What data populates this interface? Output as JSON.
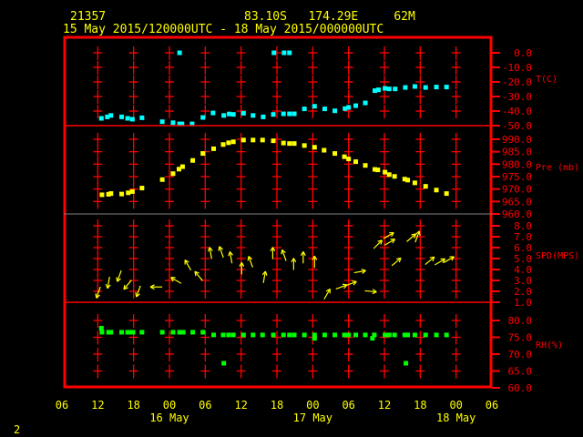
{
  "header": {
    "station_id": "21357",
    "location": "83.10S   174.29E     62M",
    "period": "15 May 2015/120000UTC - 18 May 2015/000000UTC"
  },
  "page_number": "2",
  "colors": {
    "axis": "#ff0000",
    "title": "#ffff00",
    "temperature": "#00ffff",
    "pressure": "#ffff00",
    "wind": "#ffff00",
    "rh": "#00ff00"
  },
  "chart_data": {
    "type": "scatter",
    "x_unit": "hours since 15 May 2015 12UTC",
    "xlim": [
      -6,
      66
    ],
    "x_ticks": [
      {
        "h": -6,
        "label": "06"
      },
      {
        "h": 0,
        "label": "12"
      },
      {
        "h": 6,
        "label": "18"
      },
      {
        "h": 12,
        "label": "00"
      },
      {
        "h": 18,
        "label": "06"
      },
      {
        "h": 24,
        "label": "12"
      },
      {
        "h": 30,
        "label": "18"
      },
      {
        "h": 36,
        "label": "00"
      },
      {
        "h": 42,
        "label": "06"
      },
      {
        "h": 48,
        "label": "12"
      },
      {
        "h": 54,
        "label": "18"
      },
      {
        "h": 60,
        "label": "00"
      },
      {
        "h": 66,
        "label": "06"
      }
    ],
    "date_labels": [
      {
        "h": 12,
        "label": "16 May"
      },
      {
        "h": 36,
        "label": "17 May"
      },
      {
        "h": 60,
        "label": "18 May"
      }
    ],
    "panels": [
      {
        "name": "temperature",
        "label": "T(C)",
        "ylim": [
          -50,
          0
        ],
        "ticks": [
          "0.0",
          "-10.0",
          "-20.0",
          "-30.0",
          "-40.0",
          "-50.0"
        ],
        "points": [
          [
            0.6,
            -45
          ],
          [
            1.6,
            -44
          ],
          [
            2.2,
            -43
          ],
          [
            4,
            -44
          ],
          [
            5,
            -45
          ],
          [
            5.8,
            -45.6
          ],
          [
            7.4,
            -44.6
          ],
          [
            10.8,
            -47.3
          ],
          [
            12.6,
            -48
          ],
          [
            13.7,
            -48.8
          ],
          [
            14.1,
            -48.8
          ],
          [
            15.8,
            -48.8
          ],
          [
            17.6,
            -44.4
          ],
          [
            19.3,
            -41.3
          ],
          [
            21.1,
            -43
          ],
          [
            22,
            -42
          ],
          [
            22.7,
            -42.3
          ],
          [
            24.4,
            -41.5
          ],
          [
            26,
            -43
          ],
          [
            27.7,
            -44
          ],
          [
            29.4,
            -42.3
          ],
          [
            31.1,
            -41.9
          ],
          [
            32.1,
            -41.9
          ],
          [
            32.9,
            -41.9
          ],
          [
            34.6,
            -38.5
          ],
          [
            36.3,
            -36.7
          ],
          [
            38,
            -38.5
          ],
          [
            39.7,
            -39.8
          ],
          [
            41.4,
            -38.3
          ],
          [
            42,
            -37.5
          ],
          [
            43.2,
            -36.3
          ],
          [
            44.8,
            -34.4
          ],
          [
            46.4,
            -26
          ],
          [
            47,
            -25.4
          ],
          [
            48.1,
            -24.4
          ],
          [
            48.8,
            -24.8
          ],
          [
            49.8,
            -24.8
          ],
          [
            51.5,
            -23.8
          ],
          [
            53.1,
            -23.1
          ],
          [
            54.9,
            -23.8
          ],
          [
            56.7,
            -23.5
          ],
          [
            58.4,
            -23.5
          ],
          [
            13.7,
            0
          ],
          [
            29.5,
            0
          ],
          [
            31.2,
            0
          ],
          [
            32.1,
            0
          ]
        ]
      },
      {
        "name": "pressure",
        "label": "Pre (mb)",
        "ylim": [
          960,
          990
        ],
        "ticks": [
          "990.0",
          "985.0",
          "980.0",
          "975.0",
          "970.0",
          "965.0",
          "960.0"
        ],
        "points": [
          [
            0.7,
            967.7
          ],
          [
            1.8,
            967.9
          ],
          [
            2.2,
            968.2
          ],
          [
            4,
            968
          ],
          [
            5.1,
            968.5
          ],
          [
            5.8,
            969
          ],
          [
            7.4,
            970.4
          ],
          [
            10.8,
            973.8
          ],
          [
            12.6,
            976.2
          ],
          [
            13.6,
            978
          ],
          [
            14.2,
            979
          ],
          [
            15.9,
            981.5
          ],
          [
            17.6,
            984.3
          ],
          [
            19.4,
            986.2
          ],
          [
            21,
            987.9
          ],
          [
            21.9,
            988.6
          ],
          [
            22.7,
            989
          ],
          [
            24.4,
            989.7
          ],
          [
            26,
            989.7
          ],
          [
            27.6,
            989.7
          ],
          [
            29.4,
            989.4
          ],
          [
            31.1,
            988.5
          ],
          [
            32.1,
            988.3
          ],
          [
            32.9,
            988.3
          ],
          [
            34.6,
            987.5
          ],
          [
            36.3,
            986.8
          ],
          [
            37.9,
            985.6
          ],
          [
            39.7,
            984.3
          ],
          [
            41.3,
            983
          ],
          [
            42,
            982.1
          ],
          [
            43.2,
            981
          ],
          [
            44.8,
            979.5
          ],
          [
            46.4,
            977.9
          ],
          [
            46.9,
            977.7
          ],
          [
            48.1,
            976.8
          ],
          [
            48.8,
            975.8
          ],
          [
            49.7,
            975.1
          ],
          [
            51.4,
            974
          ],
          [
            51.9,
            973.6
          ],
          [
            53.1,
            972.5
          ],
          [
            54.9,
            971.1
          ],
          [
            56.7,
            969.6
          ],
          [
            58.4,
            968.2
          ]
        ]
      },
      {
        "name": "wind",
        "label": "SPD(MPS)",
        "ylim": [
          1,
          8
        ],
        "ticks": [
          "8.0",
          "7.0",
          "6.0",
          "5.0",
          "4.0",
          "3.0",
          "2.0",
          "1.0"
        ],
        "points_h_speed_dir": [
          [
            0.1,
            1.9,
            200
          ],
          [
            1.8,
            2.8,
            190
          ],
          [
            3.6,
            3.4,
            200
          ],
          [
            5.0,
            2.6,
            220
          ],
          [
            6.8,
            2.0,
            200
          ],
          [
            9.8,
            2.4,
            270
          ],
          [
            13.1,
            3.0,
            300
          ],
          [
            15.1,
            4.4,
            330
          ],
          [
            16.9,
            3.4,
            320
          ],
          [
            18.9,
            5.5,
            350
          ],
          [
            20.7,
            5.6,
            340
          ],
          [
            22.3,
            5.1,
            350
          ],
          [
            24.1,
            4.1,
            0
          ],
          [
            25.6,
            4.7,
            340
          ],
          [
            27.9,
            3.3,
            10
          ],
          [
            29.3,
            5.5,
            0
          ],
          [
            31.2,
            5.3,
            340
          ],
          [
            32.8,
            4.5,
            0
          ],
          [
            34.4,
            5.1,
            0
          ],
          [
            36.3,
            4.7,
            0
          ],
          [
            38.4,
            1.75,
            30
          ],
          [
            40.8,
            2.4,
            70
          ],
          [
            42.4,
            2.7,
            70
          ],
          [
            43.9,
            3.8,
            80
          ],
          [
            45.7,
            2.0,
            95
          ],
          [
            46.9,
            6.3,
            45
          ],
          [
            48.7,
            7.1,
            60
          ],
          [
            48.9,
            6.5,
            60
          ],
          [
            50,
            4.7,
            50
          ],
          [
            52.5,
            6.9,
            50
          ],
          [
            53.5,
            7.0,
            20
          ],
          [
            55.6,
            4.8,
            50
          ],
          [
            57.3,
            4.7,
            60
          ],
          [
            58.8,
            4.9,
            60
          ]
        ]
      },
      {
        "name": "rh",
        "label": "RH(%)",
        "ylim": [
          60,
          80
        ],
        "ticks": [
          "80.0",
          "75.0",
          "70.0",
          "65.0",
          "60.0"
        ],
        "points": [
          [
            0.7,
            76.5
          ],
          [
            1.8,
            76.5
          ],
          [
            2.2,
            76.5
          ],
          [
            4,
            76.5
          ],
          [
            5,
            76.5
          ],
          [
            5.5,
            76.5
          ],
          [
            5.9,
            76.5
          ],
          [
            7.4,
            76.5
          ],
          [
            10.8,
            76.5
          ],
          [
            12.6,
            76.5
          ],
          [
            13.7,
            76.5
          ],
          [
            14.3,
            76.5
          ],
          [
            15.9,
            76.5
          ],
          [
            17.6,
            76.5
          ],
          [
            19.4,
            75.7
          ],
          [
            21,
            75.7
          ],
          [
            21.9,
            75.7
          ],
          [
            22.7,
            75.7
          ],
          [
            24.4,
            75.7
          ],
          [
            26,
            75.7
          ],
          [
            27.6,
            75.7
          ],
          [
            29.4,
            75.7
          ],
          [
            31.1,
            75.7
          ],
          [
            32.1,
            75.7
          ],
          [
            32.9,
            75.7
          ],
          [
            34.6,
            75.7
          ],
          [
            36.3,
            75.7
          ],
          [
            38,
            75.7
          ],
          [
            39.7,
            75.7
          ],
          [
            41.3,
            75.7
          ],
          [
            42,
            75.7
          ],
          [
            43.2,
            75.7
          ],
          [
            44.8,
            75.7
          ],
          [
            46.3,
            75.7
          ],
          [
            48.1,
            75.7
          ],
          [
            48.8,
            75.7
          ],
          [
            49.7,
            75.7
          ],
          [
            51.4,
            75.7
          ],
          [
            51.9,
            75.7
          ],
          [
            53.1,
            75.7
          ],
          [
            54.9,
            75.7
          ],
          [
            56.7,
            75.7
          ],
          [
            58.4,
            75.7
          ],
          [
            0.6,
            77.7
          ],
          [
            36.3,
            74.7
          ],
          [
            46.0,
            74.7
          ],
          [
            21.1,
            67.3
          ],
          [
            51.6,
            67.3
          ]
        ]
      }
    ]
  }
}
